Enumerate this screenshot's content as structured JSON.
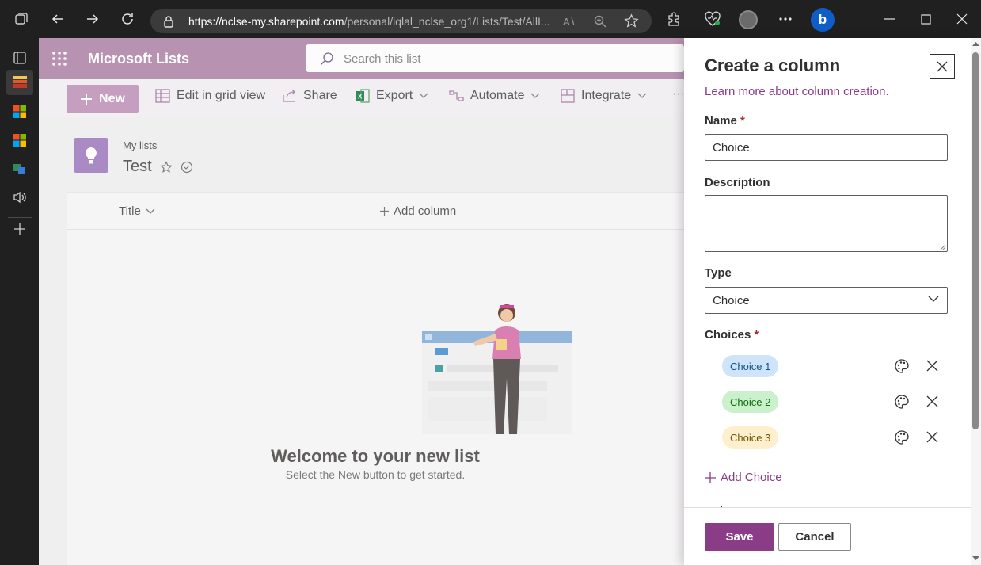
{
  "browser": {
    "url_host": "https://nclse-my.sharepoint.com",
    "url_path": "/personal/iqlal_nclse_org1/Lists/Test/AllI..."
  },
  "suite": {
    "app_title": "Microsoft Lists",
    "search_placeholder": "Search this list"
  },
  "commands": {
    "new": "New",
    "edit_grid": "Edit in grid view",
    "share": "Share",
    "export": "Export",
    "automate": "Automate",
    "integrate": "Integrate",
    "more": "···"
  },
  "list": {
    "breadcrumb": "My lists",
    "name": "Test",
    "columns": {
      "title": "Title",
      "add_column": "Add column"
    },
    "welcome_title": "Welcome to your new list",
    "welcome_subtitle": "Select the New button to get started."
  },
  "panel": {
    "title": "Create a column",
    "learn_more": "Learn more about column creation.",
    "name_label": "Name",
    "name_value": "Choice",
    "description_label": "Description",
    "type_label": "Type",
    "type_value": "Choice",
    "choices_label": "Choices",
    "required_mark": "*",
    "choices": [
      {
        "label": "Choice 1",
        "bg": "#cfe4fa",
        "fg": "#0f548c"
      },
      {
        "label": "Choice 2",
        "bg": "#caf0cc",
        "fg": "#0e700e"
      },
      {
        "label": "Choice 3",
        "bg": "#fef0cf",
        "fg": "#6d5700"
      }
    ],
    "add_choice": "Add Choice",
    "save": "Save",
    "cancel": "Cancel"
  },
  "colors": {
    "accent": "#8a3c87",
    "suite_bar": "#b892b1"
  }
}
